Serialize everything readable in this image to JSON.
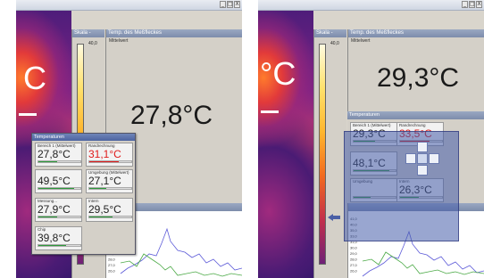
{
  "left": {
    "thermal_text": "C",
    "scale_header": "Skala -",
    "scale_top": "40,0",
    "readout_header": "Temp. des Meßfleckes",
    "readout_sub": "Mittelwert",
    "big_temp": "27,8°C",
    "temps_window_title": "Temperaturen",
    "tiles": [
      {
        "label": "Bereich 1 (Mittelwert)",
        "value": "27,8°C",
        "fill": 0.45,
        "hot": false
      },
      {
        "label": "Randrechnung",
        "value": "31,1°C",
        "fill": 0.7,
        "hot": true
      },
      {
        "label": "",
        "value": "49,5°C",
        "fill": 0.85,
        "hot": false
      },
      {
        "label": "Umgebung (Mittelwert)",
        "value": "27,1°C",
        "fill": 0.4,
        "hot": false
      },
      {
        "label": "Messung...",
        "value": "27,9°C",
        "fill": 0.45,
        "hot": false
      },
      {
        "label": "Intern",
        "value": "29,5°C",
        "fill": 0.55,
        "hot": false
      },
      {
        "label": "Chip",
        "value": "39,8°C",
        "fill": 0.65,
        "hot": false
      }
    ]
  },
  "right": {
    "thermal_text": "°C",
    "scale_header": "Skala -",
    "scale_top": "40,0",
    "readout_header": "Temp. des Meßfleckes",
    "readout_sub": "Mittelwert",
    "big_temp": "29,3°C",
    "temps_panel_title": "Temperaturen",
    "tiles": [
      {
        "label": "Bereich 1 (Mittelwert)",
        "value": "29,3°C",
        "fill": 0.5,
        "hot": false
      },
      {
        "label": "Randrechnung",
        "value": "33,5°C",
        "fill": 0.7,
        "hot": true
      },
      {
        "label": "",
        "value": "48,1°C",
        "fill": 0.85,
        "hot": false
      },
      {
        "label": "Umgebung",
        "value": "",
        "fill": 0.4,
        "hot": false
      },
      {
        "label": "Intern",
        "value": "26,3°C",
        "fill": 0.45,
        "hot": false
      }
    ]
  },
  "window_controls": [
    "_",
    "□",
    "X"
  ],
  "graph": {
    "y_ticks": [
      "41,0",
      "40,0",
      "35,0",
      "33,0",
      "31,0",
      "30,0",
      "29,0",
      "28,0",
      "27,0",
      "26,0"
    ],
    "series_colors": [
      "#5d5bd8",
      "#4caa47"
    ]
  },
  "icons": {
    "dock_compass": "dock-compass-icon",
    "dock_arrow": "dock-left-arrow-icon"
  }
}
